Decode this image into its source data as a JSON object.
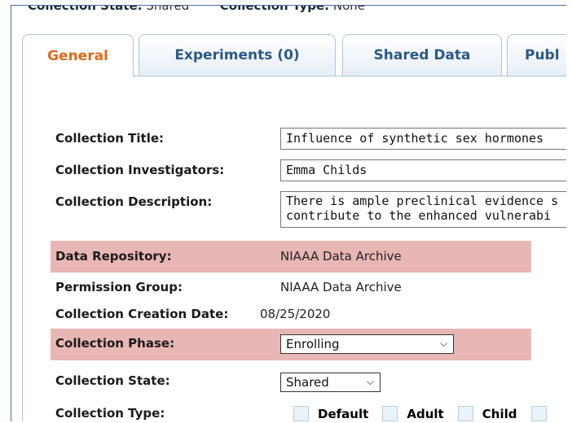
{
  "top": {
    "state_label": "Collection State:",
    "state_value": "Shared",
    "type_label": "Collection Type:",
    "type_value": "None"
  },
  "tabs": [
    {
      "label": "General",
      "active": true
    },
    {
      "label": "Experiments (0)"
    },
    {
      "label": "Shared Data"
    },
    {
      "label": "Publ"
    }
  ],
  "form": {
    "title": {
      "label": "Collection Title:",
      "value": "Influence of synthetic sex hormones"
    },
    "investigators": {
      "label": "Collection Investigators:",
      "value": "Emma Childs"
    },
    "description": {
      "label": "Collection Description:",
      "line1": "There is ample preclinical evidence s",
      "line2": "contribute to the enhanced vulnerabi"
    },
    "repository": {
      "label": "Data Repository:",
      "value": "NIAAA Data Archive"
    },
    "permission": {
      "label": "Permission Group:",
      "value": "NIAAA Data Archive"
    },
    "creation_date": {
      "label": "Collection Creation Date:",
      "value": "08/25/2020"
    },
    "phase": {
      "label": "Collection Phase:",
      "value": "Enrolling"
    },
    "state": {
      "label": "Collection State:",
      "value": "Shared"
    },
    "type": {
      "label": "Collection Type:",
      "options": [
        "Default",
        "Adult",
        "Child"
      ]
    }
  },
  "colors": {
    "highlight": "#e9b6b6",
    "active_tab": "#e06a1a",
    "tab_text": "#2a5a86"
  }
}
